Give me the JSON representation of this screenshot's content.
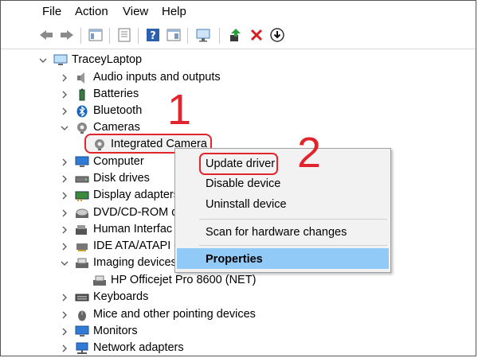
{
  "menubar": {
    "items": [
      "File",
      "Action",
      "View",
      "Help"
    ]
  },
  "toolbar": {
    "icons": [
      "back-arrow-icon",
      "forward-arrow-icon",
      "console-tree-icon",
      "properties-sheet-icon",
      "help-icon",
      "action-pane-icon",
      "monitor-scan-icon",
      "update-driver-toolbar-icon",
      "uninstall-x-icon",
      "disable-device-icon"
    ]
  },
  "tree": {
    "root": "TraceyLaptop",
    "items": [
      {
        "label": "Audio inputs and outputs",
        "icon": "speaker-icon"
      },
      {
        "label": "Batteries",
        "icon": "battery-icon"
      },
      {
        "label": "Bluetooth",
        "icon": "bluetooth-icon"
      },
      {
        "label": "Cameras",
        "icon": "webcam-icon",
        "expanded": true
      },
      {
        "label": "Integrated Camera",
        "icon": "webcam-icon",
        "child": true
      },
      {
        "label": "Computer",
        "icon": "computer-icon"
      },
      {
        "label": "Disk drives",
        "icon": "disk-drive-icon"
      },
      {
        "label": "Display adapters",
        "icon": "display-adapter-icon"
      },
      {
        "label": "DVD/CD-ROM d",
        "icon": "dvd-icon"
      },
      {
        "label": "Human Interfac",
        "icon": "hid-icon"
      },
      {
        "label": "IDE ATA/ATAPI c",
        "icon": "ide-icon"
      },
      {
        "label": "Imaging devices",
        "icon": "imaging-icon",
        "expanded": true
      },
      {
        "label": "HP Officejet Pro 8600 (NET)",
        "icon": "printer-icon",
        "child": true
      },
      {
        "label": "Keyboards",
        "icon": "keyboard-icon"
      },
      {
        "label": "Mice and other pointing devices",
        "icon": "mouse-icon"
      },
      {
        "label": "Monitors",
        "icon": "monitor-icon"
      },
      {
        "label": "Network adapters",
        "icon": "network-icon"
      }
    ]
  },
  "context_menu": {
    "items": [
      "Update driver",
      "Disable device",
      "Uninstall device",
      "Scan for hardware changes",
      "Properties"
    ]
  },
  "callouts": {
    "one": "1",
    "two": "2"
  },
  "colors": {
    "accent_red": "#e2252c",
    "highlight_blue": "#91c9f7",
    "menu_bg": "#f2f2f2"
  }
}
